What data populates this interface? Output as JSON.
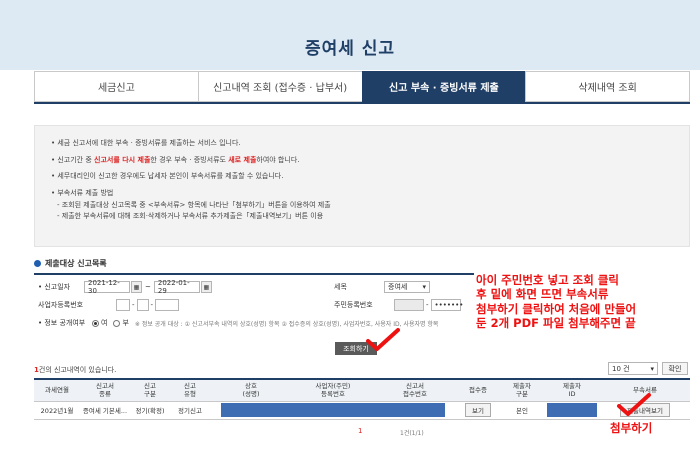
{
  "page": {
    "title": "증여세 신고"
  },
  "tabs": [
    {
      "label": "세금신고",
      "active": false
    },
    {
      "label": "신고내역 조회 (접수증 · 납부서)",
      "active": false
    },
    {
      "label": "신고 부속 · 증빙서류 제출",
      "active": true
    },
    {
      "label": "삭제내역 조회",
      "active": false
    }
  ],
  "info": {
    "l1": "세금 신고서에 대한 부속 · 증빙서류를 제출하는 서비스 입니다.",
    "l2a": "신고기간 중 ",
    "l2b": "신고서를 다시 제출",
    "l2c": "한 경우 부속 · 증빙서류도 ",
    "l2d": "새로 제출",
    "l2e": "하여야 합니다.",
    "l3": "세무대리인이 신고한 경우에도 납세자 본인이 부속서류를 제출할 수 있습니다.",
    "l4": "부속서류 제출 방법",
    "l5": "- 조회된 제출대상 신고목록 중 <부속서류> 항목에 나타난「첨부하기」버튼을 이용하여 제출",
    "l6": "- 제출한 부속서류에 대해 조회·삭제하거나 부속서류 추가제출은「제출내역보기」버튼 이용"
  },
  "section": {
    "title": "제출대상 신고목록"
  },
  "form": {
    "date_label": "신고일자",
    "date_from": "2021-12-30",
    "date_sep": "~",
    "date_to": "2022-01-29",
    "cal1": "▦",
    "cal2": "▦",
    "biz_label": "사업자등록번호",
    "tax_label": "세목",
    "tax_value": "증여세",
    "tax_caret": "▾",
    "rrn_label": "주민등록번호",
    "rrn_masked": "•••••••",
    "disclose_label": "정보 공개여부",
    "yes": "여",
    "no": "부",
    "disclose_note": "※ 정보 공개 대상 : ① 신고서부속 내역의 상호(성명) 항목 ② 접수증의 상호(성명), 사업자번호, 사용자 ID, 사용자명 항목"
  },
  "search_button": "조회하기",
  "results": {
    "count_num": "1",
    "count_text": "건의 신고내역이 있습니다.",
    "page_size": "10 건",
    "page_size_caret": "▾",
    "confirm": "확인"
  },
  "table": {
    "headers": [
      "과세연월",
      "신고서\n종류",
      "신고\n구분",
      "신고\n유형",
      "상호\n(성명)",
      "사업자(주민)\n등록번호",
      "신고서\n접수번호",
      "접수증",
      "제출자\n구분",
      "제출자\nID",
      "부속서류"
    ],
    "row": {
      "period": "2022년1월",
      "kind": "증여세 기본세...",
      "div": "정기(확정)",
      "type": "정기신고",
      "receipt_btn": "보기",
      "submitter_type": "본인",
      "attach_btn": "제출내역보기"
    }
  },
  "pagination": {
    "current": "1",
    "info": "1건(1/1)"
  },
  "annotation": {
    "line1": "아이 주민번호 넣고 조회 클릭",
    "line2": "후 밑에 화면 뜨면 부속서류",
    "line3": "첨부하기 클릭하여 처음에 만들어",
    "line4": "둔 2개 PDF 파일 첨부해주면 끝",
    "attach": "첨부하기"
  },
  "colors": {
    "navy": "#1f3f66",
    "mask": "#3f6db3",
    "annotation": "#e11111"
  }
}
